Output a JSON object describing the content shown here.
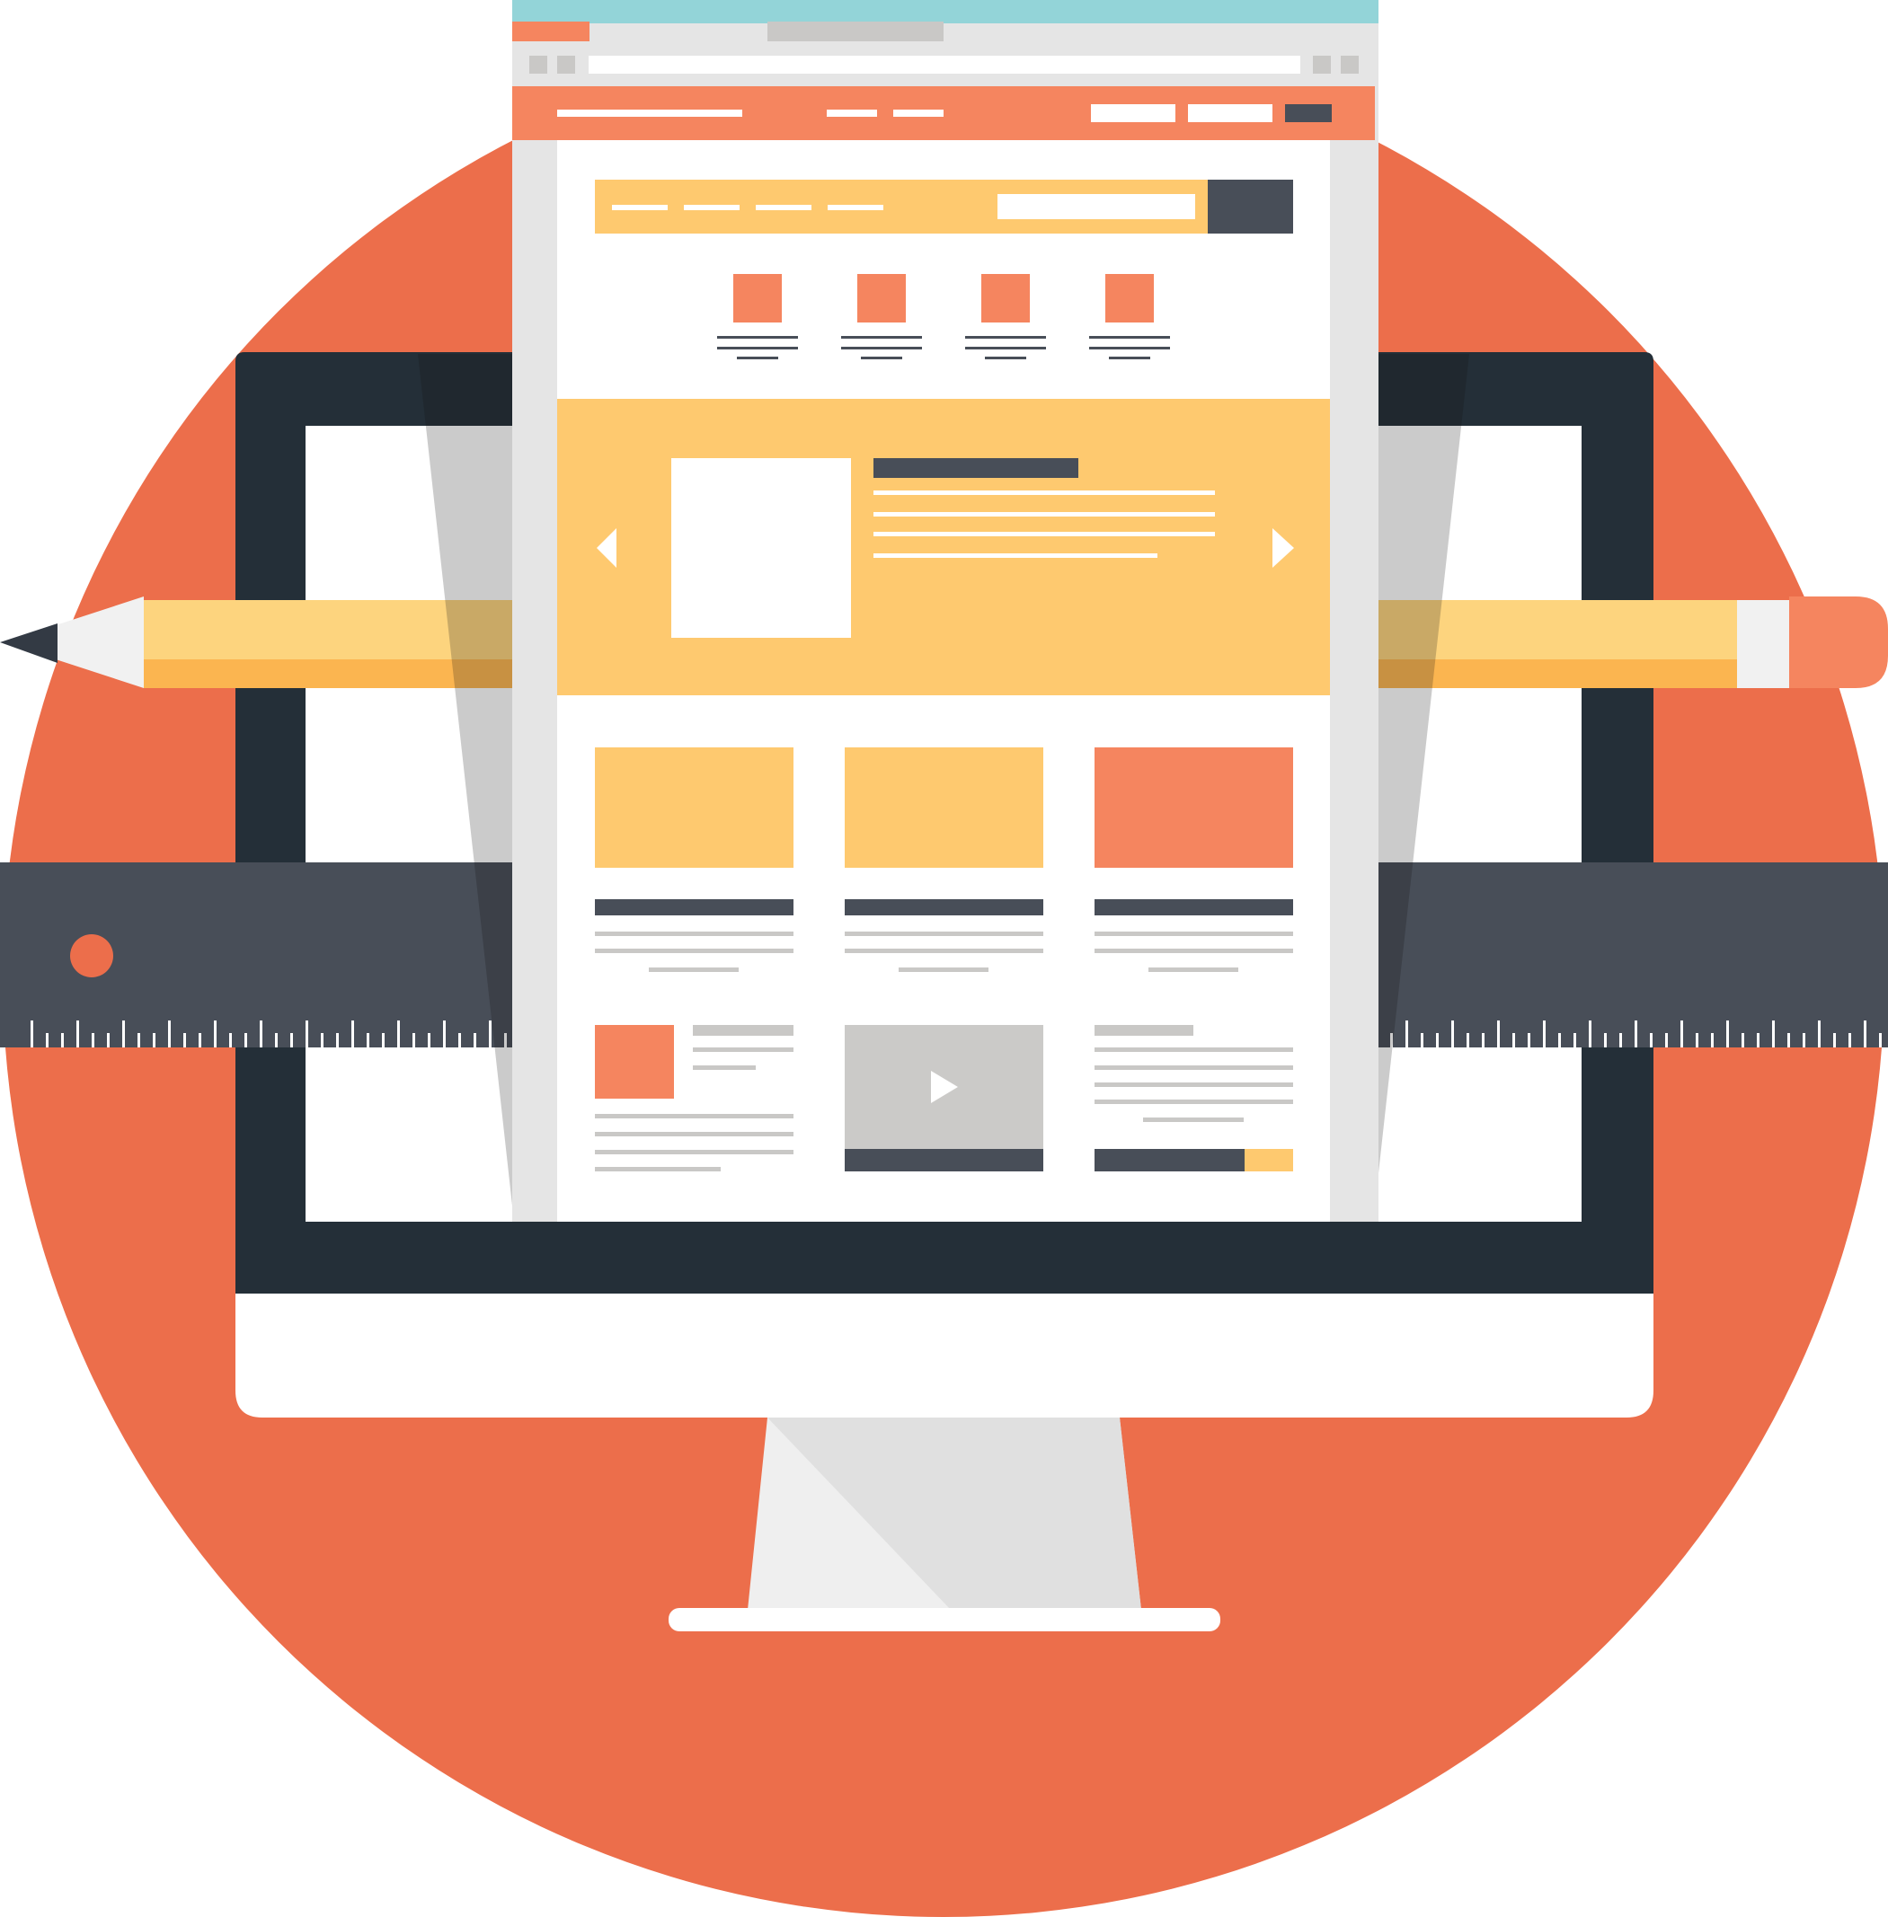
{
  "illustration": {
    "subject": "",
    "colors": {
      "circle": "#ec6e4b",
      "monitor_frame": "#242f38",
      "monitor_chin": "#ffffff",
      "stand": "#efefef",
      "stand_shade": "#e0e0e0",
      "ruler": "#484e58",
      "ruler_hole": "#ec6e4b",
      "ruler_ticks": "#ffffff",
      "pencil_body": "#fdd47e",
      "pencil_body_shade": "#fbb550",
      "pencil_wood": "#f1f1f1",
      "pencil_lead": "#333a44",
      "pencil_eraser": "#f5855f",
      "page_gutter": "#e5e5e5",
      "page_bg": "#ffffff",
      "browser_bar": "#93d4d8",
      "browser_tab_active": "#f5855f",
      "browser_tab_inactive": "#c9c8c6",
      "nav_bar": "#f5855f",
      "accent_yellow": "#fec96f",
      "accent_orange": "#f5855f",
      "dark_text": "#484e58",
      "light_text": "#c9c8c6",
      "video_bg": "#cbcac8",
      "shadow": "rgba(20,20,20,0.22)"
    },
    "icons": [
      "play-icon",
      "arrow-left-icon",
      "arrow-right-icon"
    ]
  }
}
